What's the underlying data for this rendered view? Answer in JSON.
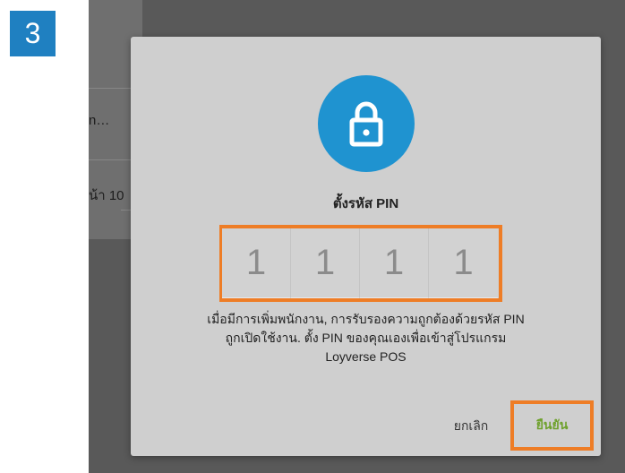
{
  "step": {
    "number": "3"
  },
  "background": {
    "item1_text": "n…",
    "item2_text": "น้า 10"
  },
  "dialog": {
    "icon": "lock-icon",
    "title": "ตั้งรหัส PIN",
    "pin_digits": [
      "1",
      "1",
      "1",
      "1"
    ],
    "description_line1": "เมื่อมีการเพิ่มพนักงาน, การรับรองความถูกต้องด้วยรหัส PIN",
    "description_line2": "ถูกเปิดใช้งาน. ตั้ง PIN ของคุณเองเพื่อเข้าสู่โปรแกรม",
    "description_line3": "Loyverse POS",
    "cancel_label": "ยกเลิก",
    "confirm_label": "ยืนยัน"
  },
  "colors": {
    "accent_blue": "#1f93d0",
    "highlight_orange": "#ee7d26",
    "confirm_green": "#6fa12d",
    "badge_blue": "#1f80c1"
  }
}
